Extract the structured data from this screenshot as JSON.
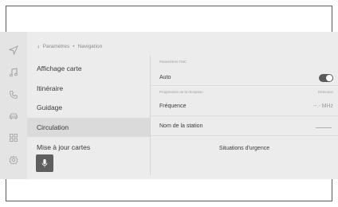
{
  "breadcrumb": {
    "back_symbol": "‹",
    "parent": "Paramètres",
    "separator": "•",
    "current": "Navigation"
  },
  "rail_icons": [
    "navigation-icon",
    "music-icon",
    "phone-icon",
    "car-icon",
    "apps-icon",
    "settings-icon"
  ],
  "menu": {
    "items": [
      {
        "label": "Affichage carte"
      },
      {
        "label": "Itinéraire"
      },
      {
        "label": "Guidage"
      },
      {
        "label": "Circulation",
        "selected": true
      },
      {
        "label": "Mise à jour cartes"
      }
    ]
  },
  "detail": {
    "tmc_section": "Paramètres TMC",
    "auto_label": "Auto",
    "auto_toggle_on": true,
    "detection_label": "Détection",
    "reception_section": "Progression de la réception",
    "frequency_label": "Fréquence",
    "frequency_value": "--.- MHz",
    "station_label": "Nom de la station",
    "emergency_label": "Situations d'urgence"
  },
  "colors": {
    "screen_bg": "#ececec",
    "selected_row": "#dadada",
    "toggle_on": "#5a5a5a",
    "mic_button": "#5e5e5e"
  }
}
